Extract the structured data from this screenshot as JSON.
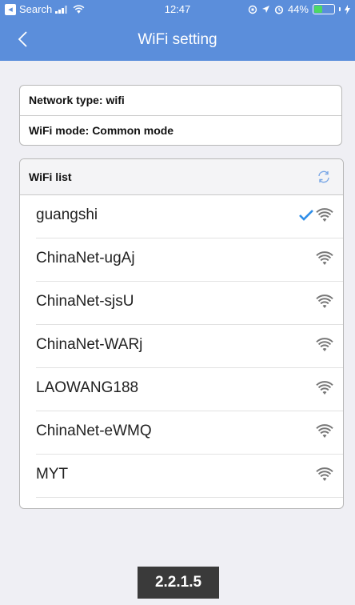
{
  "status_bar": {
    "back_app": "Search",
    "time": "12:47",
    "battery": "44%",
    "battery_level": 0.44
  },
  "nav": {
    "title": "WiFi setting"
  },
  "info": {
    "network_type": "Network type:  wifi",
    "wifi_mode": "WiFi mode:  Common mode"
  },
  "wifi_list": {
    "header": "WiFi list",
    "items": [
      {
        "name": "guangshi",
        "connected": true
      },
      {
        "name": "ChinaNet-ugAj",
        "connected": false
      },
      {
        "name": "ChinaNet-sjsU",
        "connected": false
      },
      {
        "name": "ChinaNet-WARj",
        "connected": false
      },
      {
        "name": "LAOWANG188",
        "connected": false
      },
      {
        "name": "ChinaNet-eWMQ",
        "connected": false
      },
      {
        "name": "MYT",
        "connected": false
      }
    ]
  },
  "version_label": "2.2.1.5",
  "colors": {
    "accent": "#5b8edb",
    "check": "#2f8ee8"
  }
}
